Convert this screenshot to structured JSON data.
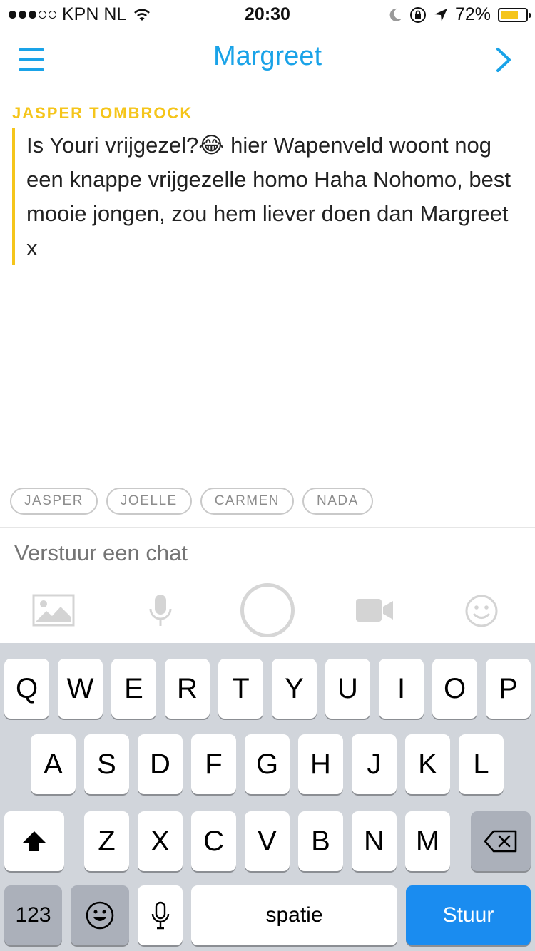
{
  "status_bar": {
    "carrier": "KPN NL",
    "time": "20:30",
    "battery": "72%",
    "battery_level": 0.72,
    "signal_bars": 3,
    "signal_total": 5
  },
  "header": {
    "title": "Margreet",
    "menu_icon": "hamburger-icon",
    "next_icon": "chevron-right-icon"
  },
  "chat": {
    "sender": "JASPER TOMBROCK",
    "message": "Is Youri vrijgezel?😂 hier Wapenveld woont nog een knappe vrijgezelle homo Haha Nohomo, best mooie jongen, zou hem liever doen dan Margreet x"
  },
  "mentions": [
    "JASPER",
    "JOELLE",
    "CARMEN",
    "NADA"
  ],
  "input": {
    "placeholder": "Verstuur een chat"
  },
  "toolbar": {
    "icons": [
      "image-icon",
      "microphone-icon",
      "capture-button",
      "video-camera-icon",
      "smiley-icon"
    ]
  },
  "keyboard": {
    "row1": [
      "Q",
      "W",
      "E",
      "R",
      "T",
      "Y",
      "U",
      "I",
      "O",
      "P"
    ],
    "row2": [
      "A",
      "S",
      "D",
      "F",
      "G",
      "H",
      "J",
      "K",
      "L"
    ],
    "row3": [
      "Z",
      "X",
      "C",
      "V",
      "B",
      "N",
      "M"
    ],
    "numbers_label": "123",
    "space_label": "spatie",
    "send_label": "Stuur"
  },
  "colors": {
    "accent_blue": "#1aa3e8",
    "sender_yellow": "#f5c51b",
    "send_key": "#1a8cf0"
  }
}
